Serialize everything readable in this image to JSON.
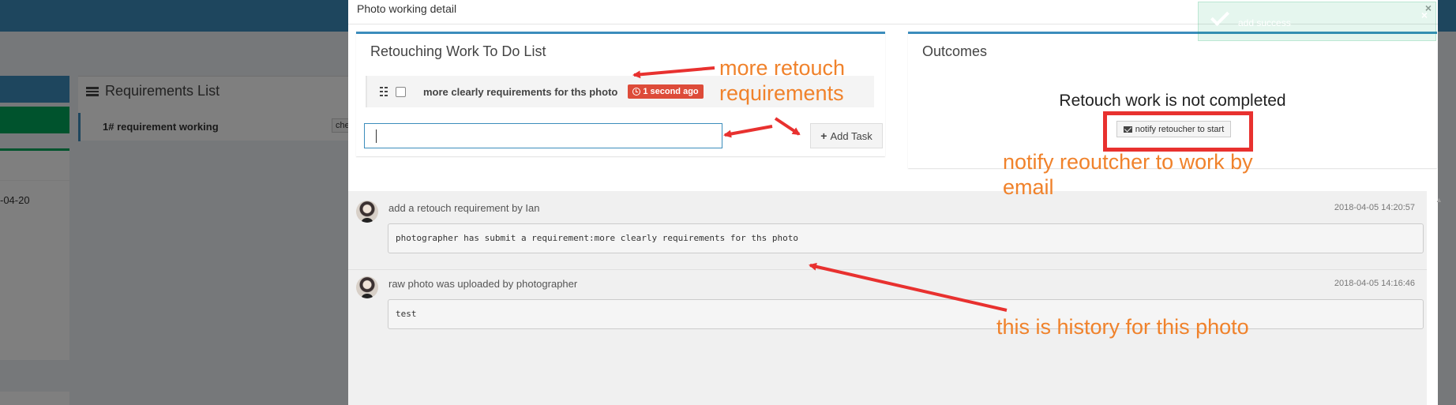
{
  "background": {
    "requirements_title": "Requirements List",
    "requirement_item": "1# requirement working",
    "requirement_button": "che",
    "date_fragment": "-04-20"
  },
  "modal": {
    "title": "Photo working detail",
    "close": "×"
  },
  "todo": {
    "title": "Retouching Work To Do List",
    "items": [
      {
        "text": "more clearly requirements for ths photo",
        "badge": "1 second ago"
      }
    ],
    "input_value": "",
    "add_button": "Add Task"
  },
  "outcomes": {
    "title": "Outcomes",
    "status": "Retouch work is not completed",
    "notify_button": "notify retoucher to start"
  },
  "history": [
    {
      "title": "add a retouch requirement by Ian",
      "time": "2018-04-05 14:20:57",
      "body": "photographer has submit a requirement:more clearly requirements for ths photo"
    },
    {
      "title": "raw photo was uploaded by photographer",
      "time": "2018-04-05 14:16:46",
      "body": "test"
    }
  ],
  "toast": {
    "text": "add success",
    "close": "×"
  },
  "annotations": {
    "retouch": "more retouch requirements",
    "notify": "notify reoutcher to work by email",
    "history": "this is history for this photo"
  },
  "colors": {
    "primary": "#3c8dbc",
    "success": "#00a65a",
    "danger": "#dd4b39",
    "annotation": "#f0822b",
    "highlight": "#e8312f"
  }
}
